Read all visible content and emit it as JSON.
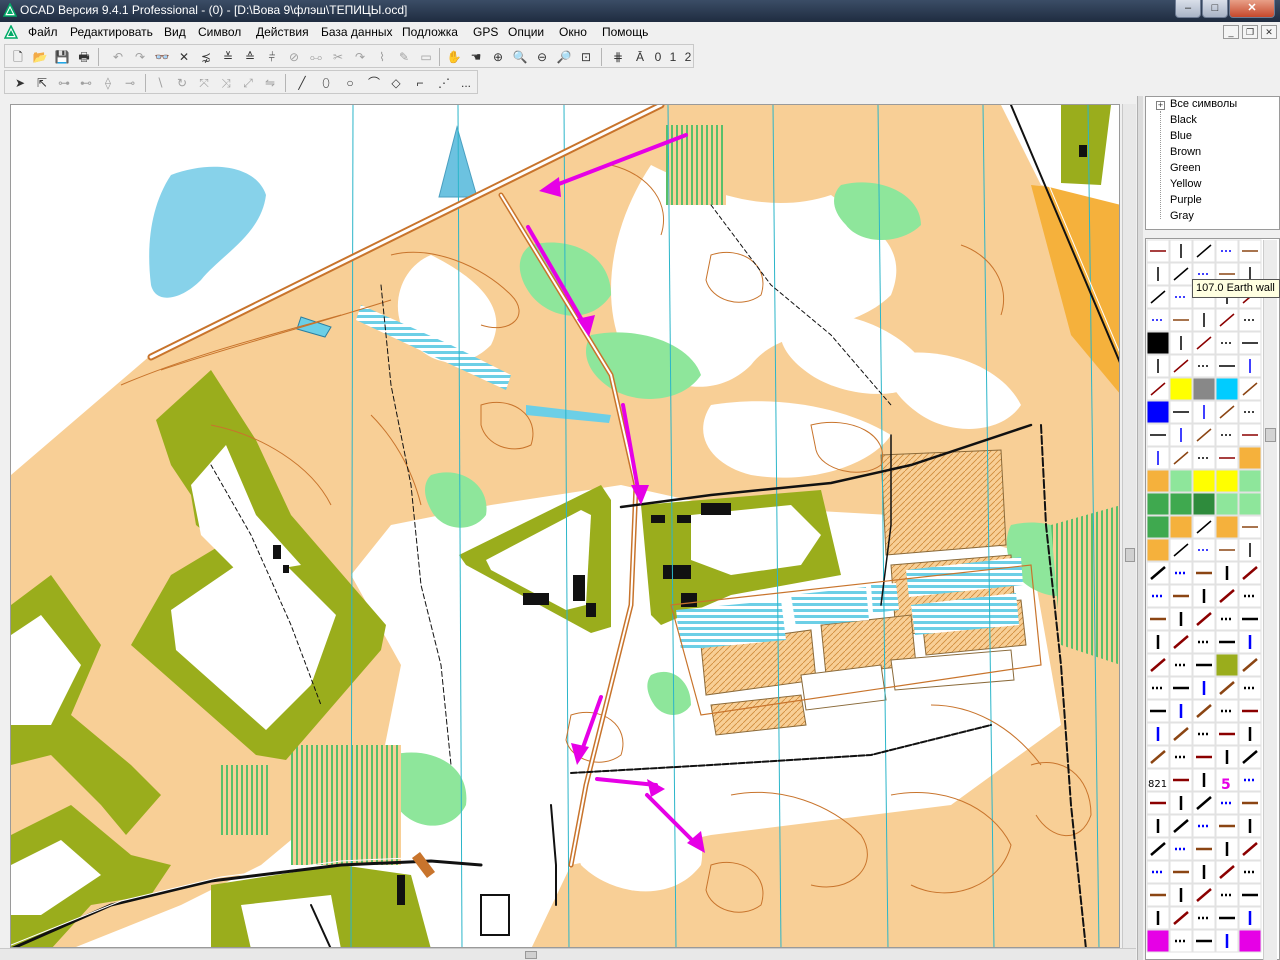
{
  "window": {
    "title": "OCAD Версия 9.4.1  Professional  -  (0) - [D:\\Вова 9\\флэш\\ТЕПИЦЫ.ocd]",
    "controls": [
      "–",
      "□",
      "✕"
    ]
  },
  "menu": {
    "items": [
      "Файл",
      "Редактировать",
      "Вид",
      "Символ",
      "Действия",
      "База данных",
      "Подложка",
      "GPS",
      "Опции",
      "Окно",
      "Помощь"
    ]
  },
  "toolbar": {
    "zoom_labels": [
      "0",
      "1",
      "2"
    ],
    "more_label": "..."
  },
  "symbol_tree": {
    "root": "Все символы",
    "colors": [
      "Black",
      "Blue",
      "Brown",
      "Green",
      "Yellow",
      "Purple",
      "Gray"
    ]
  },
  "tooltip": {
    "text": "107.0 Earth wall"
  },
  "palette": {
    "visible_labels": [
      "821",
      "5"
    ]
  },
  "colors": {
    "map_yellow": "#f8cf96",
    "map_olive": "#9aad1c",
    "map_green": "#8ee69b",
    "map_blue": "#6ccfe6",
    "map_purple": "#e600e6",
    "map_brown": "#c8742c",
    "grid_line": "#2bb5c9"
  }
}
